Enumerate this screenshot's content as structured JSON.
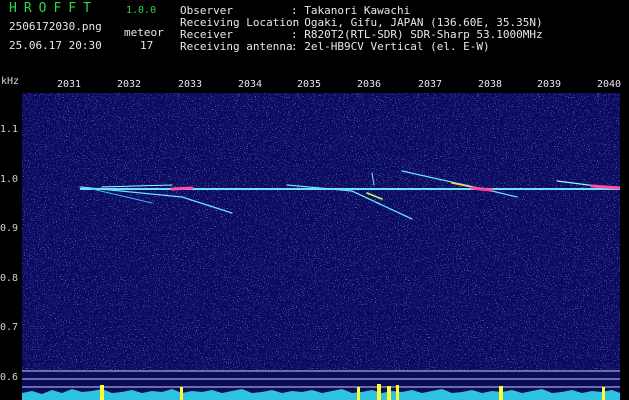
{
  "header": {
    "logo": "HROFFT",
    "version": "1.0.0",
    "filename": "2506172030.png",
    "datetime": "25.06.17 20:30",
    "meteor_label": "meteor",
    "meteor_count": "17",
    "observer_label": "Observer",
    "observer_value": ": Takanori Kawachi",
    "location_label": "Receiving Location",
    "location_value": ": Ogaki, Gifu, JAPAN (136.60E, 35.35N)",
    "receiver_label": "Receiver",
    "receiver_value": ": R820T2(RTL-SDR) SDR-Sharp 53.1000MHz",
    "antenna_label": "Receiving antenna",
    "antenna_value": ": 2el-HB9CV Vertical (el. E-W)"
  },
  "axis": {
    "y_unit": "kHz",
    "y_ticks": [
      "1.1",
      "1.0",
      "0.9",
      "0.8",
      "0.7",
      "0.6"
    ],
    "x_ticks": [
      "2031",
      "2032",
      "2033",
      "2034",
      "2035",
      "2036",
      "2037",
      "2038",
      "2039",
      "2040"
    ]
  },
  "colors": {
    "background": "#0a0a5e",
    "carrier": "#6fe0ff",
    "meteor_hot": "#ff4da6",
    "logo": "#2fd64a",
    "spectrum_fill": "#2ec4e0",
    "spectrum_peak": "#ffff33"
  }
}
